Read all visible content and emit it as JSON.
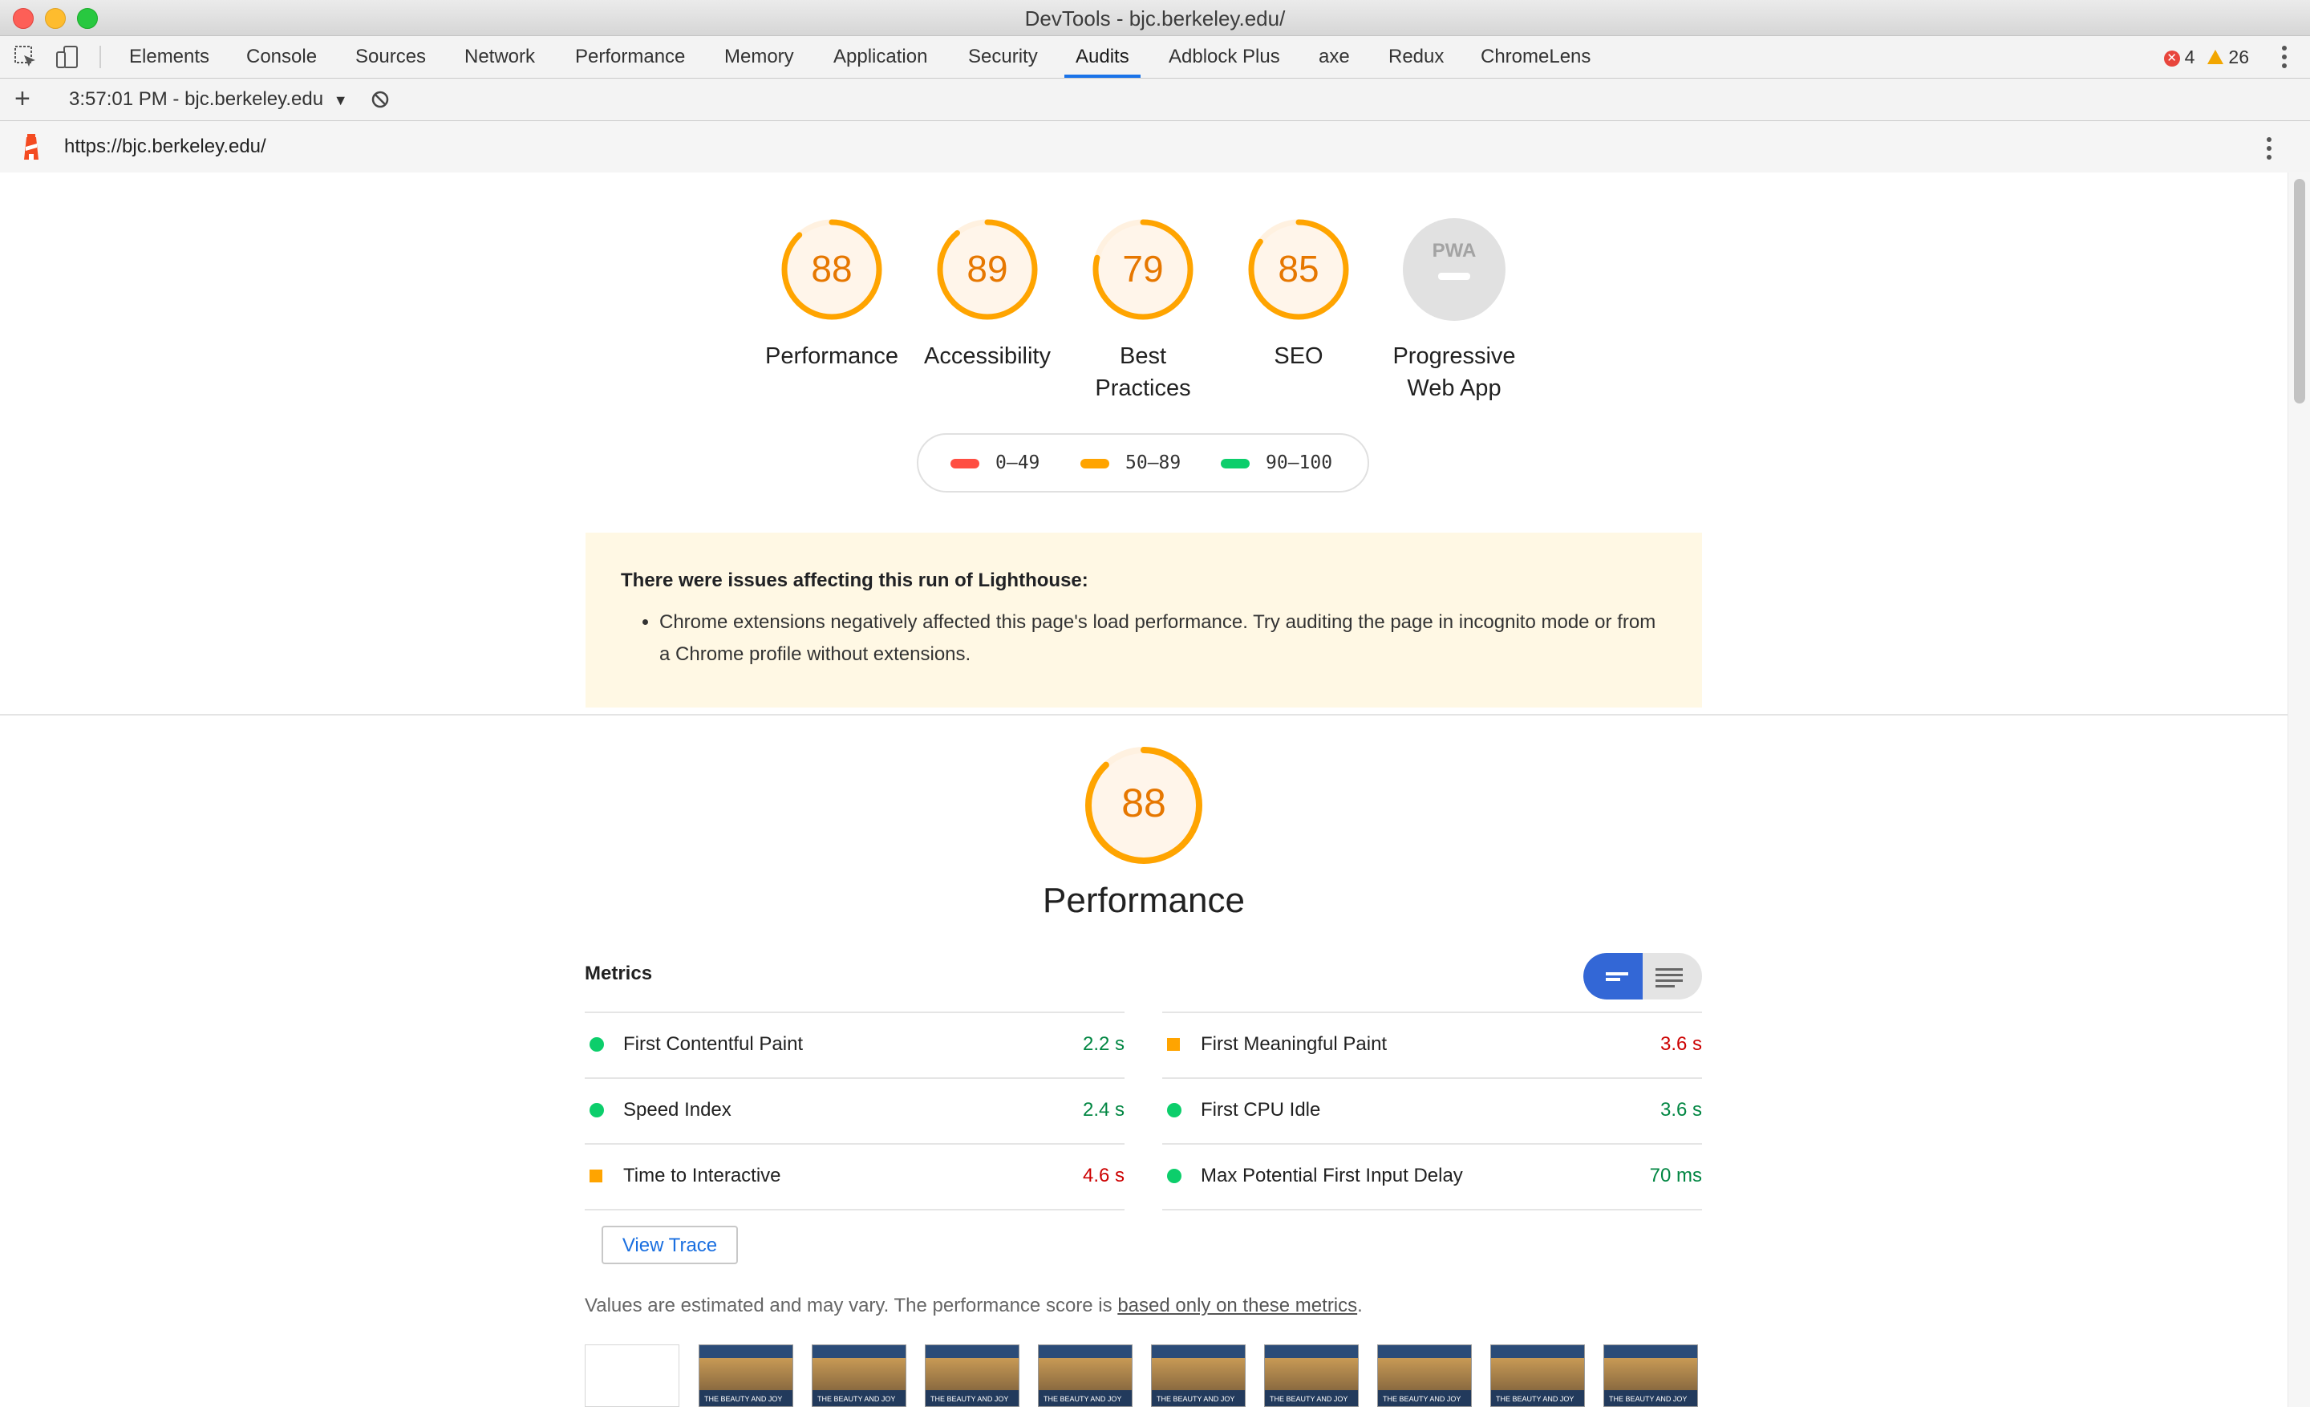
{
  "window": {
    "title": "DevTools - bjc.berkeley.edu/"
  },
  "tabs": [
    "Elements",
    "Console",
    "Sources",
    "Network",
    "Performance",
    "Memory",
    "Application",
    "Security",
    "Audits",
    "Adblock Plus",
    "axe",
    "Redux",
    "ChromeLens"
  ],
  "active_tab": "Audits",
  "counts": {
    "errors": "4",
    "warnings": "26"
  },
  "report_bar": {
    "run_label": "3:57:01 PM - bjc.berkeley.edu",
    "dropdown_arrow": "▼"
  },
  "url": "https://bjc.berkeley.edu/",
  "gauges": [
    {
      "score": "88",
      "label": "Performance"
    },
    {
      "score": "89",
      "label": "Accessibility"
    },
    {
      "score": "79",
      "label": "Best Practices",
      "label1": "Best",
      "label2": "Practices"
    },
    {
      "score": "85",
      "label": "SEO"
    },
    {
      "score": "PWA",
      "label": "Progressive Web App",
      "label1": "Progressive",
      "label2": "Web App"
    }
  ],
  "score_fractions": [
    0.88,
    0.89,
    0.79,
    0.85
  ],
  "legend": [
    {
      "range": "0–49",
      "color": "#ff4e42"
    },
    {
      "range": "50–89",
      "color": "#ffa400"
    },
    {
      "range": "90–100",
      "color": "#0cce6b"
    }
  ],
  "warning": {
    "title": "There were issues affecting this run of Lighthouse:",
    "item": "Chrome extensions negatively affected this page's load performance. Try auditing the page in incognito mode or from a Chrome profile without extensions."
  },
  "performance": {
    "score": "88",
    "title": "Performance",
    "metrics_heading": "Metrics",
    "metrics": [
      {
        "name": "First Contentful Paint",
        "value": "2.2 s",
        "status": "pass"
      },
      {
        "name": "First Meaningful Paint",
        "value": "3.6 s",
        "status": "average"
      },
      {
        "name": "Speed Index",
        "value": "2.4 s",
        "status": "pass"
      },
      {
        "name": "First CPU Idle",
        "value": "3.6 s",
        "status": "pass"
      },
      {
        "name": "Time to Interactive",
        "value": "4.6 s",
        "status": "average"
      },
      {
        "name": "Max Potential First Input Delay",
        "value": "70 ms",
        "status": "pass"
      }
    ],
    "view_trace_label": "View Trace",
    "disclaimer_text": "Values are estimated and may vary. The performance score is ",
    "disclaimer_link": "based only on these metrics",
    "disclaimer_end": ".",
    "filmstrip_caption": "THE BEAUTY AND JOY"
  },
  "colors": {
    "accent": "#1a73e8",
    "average": "#ffa400",
    "pass": "#0cce6b",
    "fail": "#ff4e42"
  }
}
